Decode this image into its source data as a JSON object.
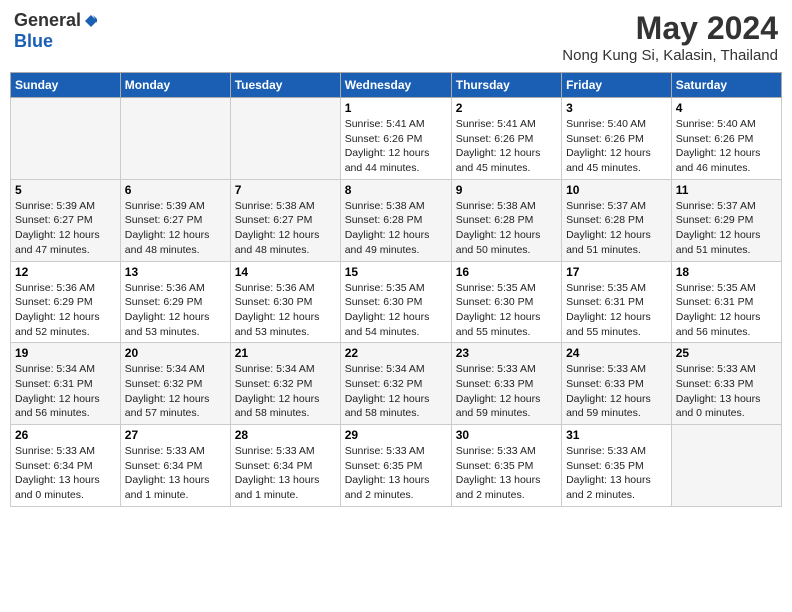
{
  "logo": {
    "general": "General",
    "blue": "Blue"
  },
  "title": "May 2024",
  "location": "Nong Kung Si, Kalasin, Thailand",
  "days_of_week": [
    "Sunday",
    "Monday",
    "Tuesday",
    "Wednesday",
    "Thursday",
    "Friday",
    "Saturday"
  ],
  "weeks": [
    [
      {
        "day": "",
        "info": ""
      },
      {
        "day": "",
        "info": ""
      },
      {
        "day": "",
        "info": ""
      },
      {
        "day": "1",
        "info": "Sunrise: 5:41 AM\nSunset: 6:26 PM\nDaylight: 12 hours\nand 44 minutes."
      },
      {
        "day": "2",
        "info": "Sunrise: 5:41 AM\nSunset: 6:26 PM\nDaylight: 12 hours\nand 45 minutes."
      },
      {
        "day": "3",
        "info": "Sunrise: 5:40 AM\nSunset: 6:26 PM\nDaylight: 12 hours\nand 45 minutes."
      },
      {
        "day": "4",
        "info": "Sunrise: 5:40 AM\nSunset: 6:26 PM\nDaylight: 12 hours\nand 46 minutes."
      }
    ],
    [
      {
        "day": "5",
        "info": "Sunrise: 5:39 AM\nSunset: 6:27 PM\nDaylight: 12 hours\nand 47 minutes."
      },
      {
        "day": "6",
        "info": "Sunrise: 5:39 AM\nSunset: 6:27 PM\nDaylight: 12 hours\nand 48 minutes."
      },
      {
        "day": "7",
        "info": "Sunrise: 5:38 AM\nSunset: 6:27 PM\nDaylight: 12 hours\nand 48 minutes."
      },
      {
        "day": "8",
        "info": "Sunrise: 5:38 AM\nSunset: 6:28 PM\nDaylight: 12 hours\nand 49 minutes."
      },
      {
        "day": "9",
        "info": "Sunrise: 5:38 AM\nSunset: 6:28 PM\nDaylight: 12 hours\nand 50 minutes."
      },
      {
        "day": "10",
        "info": "Sunrise: 5:37 AM\nSunset: 6:28 PM\nDaylight: 12 hours\nand 51 minutes."
      },
      {
        "day": "11",
        "info": "Sunrise: 5:37 AM\nSunset: 6:29 PM\nDaylight: 12 hours\nand 51 minutes."
      }
    ],
    [
      {
        "day": "12",
        "info": "Sunrise: 5:36 AM\nSunset: 6:29 PM\nDaylight: 12 hours\nand 52 minutes."
      },
      {
        "day": "13",
        "info": "Sunrise: 5:36 AM\nSunset: 6:29 PM\nDaylight: 12 hours\nand 53 minutes."
      },
      {
        "day": "14",
        "info": "Sunrise: 5:36 AM\nSunset: 6:30 PM\nDaylight: 12 hours\nand 53 minutes."
      },
      {
        "day": "15",
        "info": "Sunrise: 5:35 AM\nSunset: 6:30 PM\nDaylight: 12 hours\nand 54 minutes."
      },
      {
        "day": "16",
        "info": "Sunrise: 5:35 AM\nSunset: 6:30 PM\nDaylight: 12 hours\nand 55 minutes."
      },
      {
        "day": "17",
        "info": "Sunrise: 5:35 AM\nSunset: 6:31 PM\nDaylight: 12 hours\nand 55 minutes."
      },
      {
        "day": "18",
        "info": "Sunrise: 5:35 AM\nSunset: 6:31 PM\nDaylight: 12 hours\nand 56 minutes."
      }
    ],
    [
      {
        "day": "19",
        "info": "Sunrise: 5:34 AM\nSunset: 6:31 PM\nDaylight: 12 hours\nand 56 minutes."
      },
      {
        "day": "20",
        "info": "Sunrise: 5:34 AM\nSunset: 6:32 PM\nDaylight: 12 hours\nand 57 minutes."
      },
      {
        "day": "21",
        "info": "Sunrise: 5:34 AM\nSunset: 6:32 PM\nDaylight: 12 hours\nand 58 minutes."
      },
      {
        "day": "22",
        "info": "Sunrise: 5:34 AM\nSunset: 6:32 PM\nDaylight: 12 hours\nand 58 minutes."
      },
      {
        "day": "23",
        "info": "Sunrise: 5:33 AM\nSunset: 6:33 PM\nDaylight: 12 hours\nand 59 minutes."
      },
      {
        "day": "24",
        "info": "Sunrise: 5:33 AM\nSunset: 6:33 PM\nDaylight: 12 hours\nand 59 minutes."
      },
      {
        "day": "25",
        "info": "Sunrise: 5:33 AM\nSunset: 6:33 PM\nDaylight: 13 hours\nand 0 minutes."
      }
    ],
    [
      {
        "day": "26",
        "info": "Sunrise: 5:33 AM\nSunset: 6:34 PM\nDaylight: 13 hours\nand 0 minutes."
      },
      {
        "day": "27",
        "info": "Sunrise: 5:33 AM\nSunset: 6:34 PM\nDaylight: 13 hours\nand 1 minute."
      },
      {
        "day": "28",
        "info": "Sunrise: 5:33 AM\nSunset: 6:34 PM\nDaylight: 13 hours\nand 1 minute."
      },
      {
        "day": "29",
        "info": "Sunrise: 5:33 AM\nSunset: 6:35 PM\nDaylight: 13 hours\nand 2 minutes."
      },
      {
        "day": "30",
        "info": "Sunrise: 5:33 AM\nSunset: 6:35 PM\nDaylight: 13 hours\nand 2 minutes."
      },
      {
        "day": "31",
        "info": "Sunrise: 5:33 AM\nSunset: 6:35 PM\nDaylight: 13 hours\nand 2 minutes."
      },
      {
        "day": "",
        "info": ""
      }
    ]
  ]
}
